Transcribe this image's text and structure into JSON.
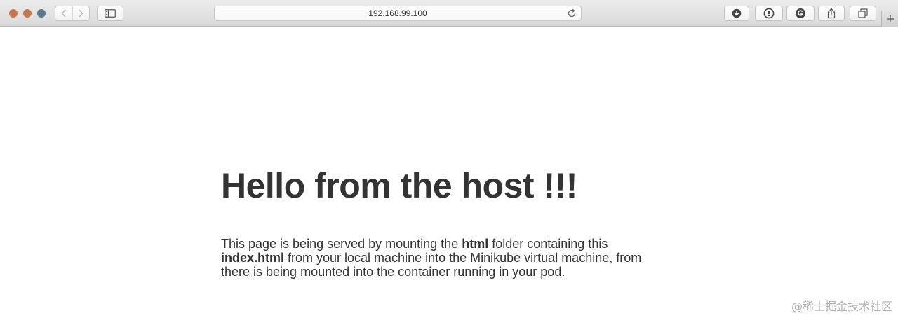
{
  "window": {
    "traffic_lights": {
      "close_color": "#c6764e",
      "minimize_color": "#c6764e",
      "maximize_color": "#5c7591"
    }
  },
  "toolbar": {
    "back_icon": "chevron-left-icon",
    "forward_icon": "chevron-right-icon",
    "sidebar_icon": "sidebar-icon",
    "address": "192.168.99.100",
    "reload_icon": "reload-icon",
    "right_buttons": [
      "download-icon",
      "info-icon",
      "grammarly-icon",
      "share-icon",
      "tabs-overview-icon"
    ],
    "new_tab_icon": "plus-icon"
  },
  "page": {
    "heading": "Hello from the host !!!",
    "paragraph": {
      "part1": "This page is being served by mounting the ",
      "bold1": "html",
      "part2": " folder containing this ",
      "bold2": "index.html",
      "part3": " from your local machine into the Minikube virtual machine, from there is being mounted into the container running in your pod."
    }
  },
  "watermark": "@稀土掘金技术社区"
}
